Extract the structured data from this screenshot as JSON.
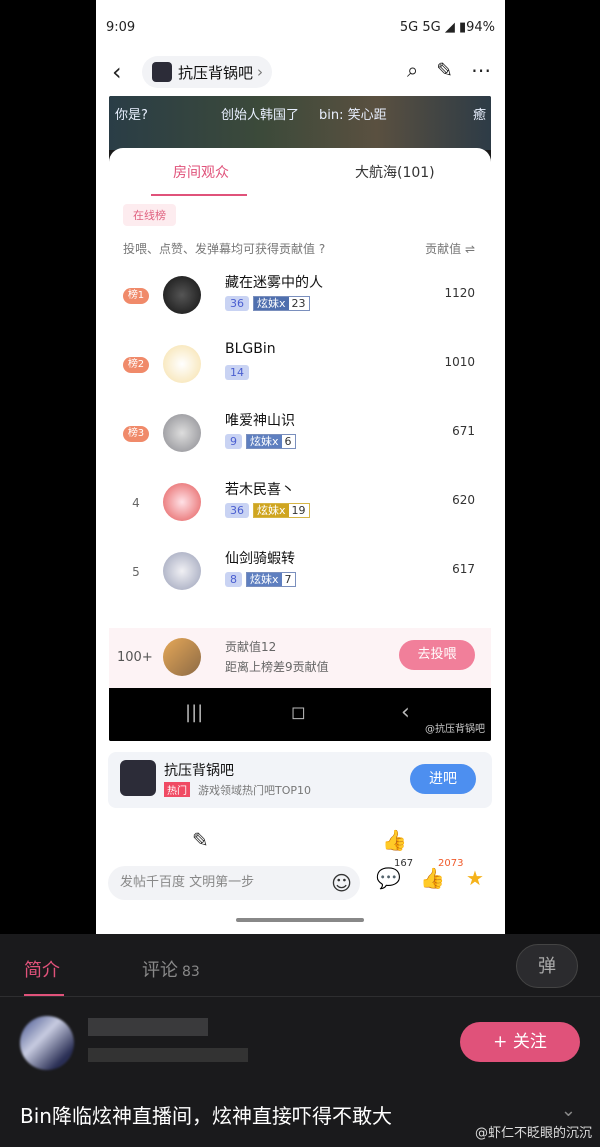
{
  "status": {
    "time": "9:09",
    "right": "5G 5G ◢ ▮94%"
  },
  "nav": {
    "back": "‹",
    "forum": "抗压背锅吧",
    "chev": "›"
  },
  "danmaku": [
    "你是?",
    "创始人韩国了",
    "bin: 笑心距",
    "癒"
  ],
  "panel": {
    "tab1": "房间观众",
    "tab2": "大航海(101)",
    "online": "在线榜",
    "hint": "投喂、点赞、发弹幕均可获得贡献值 ?",
    "hint_right": "贡献值 ⇌",
    "rows": [
      {
        "rank": "榜1",
        "name": "藏在迷雾中的人",
        "lv": "36",
        "fan": "炫妹x",
        "fan_lv": "23",
        "score": "1120"
      },
      {
        "rank": "榜2",
        "name": "BLGBin",
        "lv": "14",
        "fan": "",
        "fan_lv": "",
        "score": "1010"
      },
      {
        "rank": "榜3",
        "name": "唯爱神山识",
        "lv": "9",
        "fan": "炫妹x",
        "fan_lv": "6",
        "score": "671"
      },
      {
        "rank": "4",
        "name": "若木民喜丶",
        "lv": "36",
        "fan": "炫妹x",
        "fan_lv": "19",
        "score": "620"
      },
      {
        "rank": "5",
        "name": "仙剑骑蝦转",
        "lv": "8",
        "fan": "炫妹x",
        "fan_lv": "7",
        "score": "617"
      }
    ],
    "me": {
      "rank": "100+",
      "line1": "贡献值12",
      "line2": "距离上榜差9贡献值",
      "button": "去投喂"
    }
  },
  "android": {
    "watermark": "@抗压背锅吧"
  },
  "forum_card": {
    "name": "抗压背锅吧",
    "hot": "热门",
    "desc": "游戏领域热门吧TOP10",
    "button": "进吧"
  },
  "reply": {
    "placeholder": "发帖千百度 文明第一步",
    "comments": "167",
    "likes": "2073"
  },
  "bottom": {
    "tab1": "简介",
    "tab2": "评论",
    "tab2_count": "83",
    "danmaku": "弹",
    "follow": "+ 关注",
    "title": "Bin降临炫神直播间，炫神直接吓得不敢大",
    "watermark": "@虾仁不眨眼的沉沉"
  },
  "colors": {
    "accent": "#e0527a",
    "blue": "#4d8ff0"
  }
}
